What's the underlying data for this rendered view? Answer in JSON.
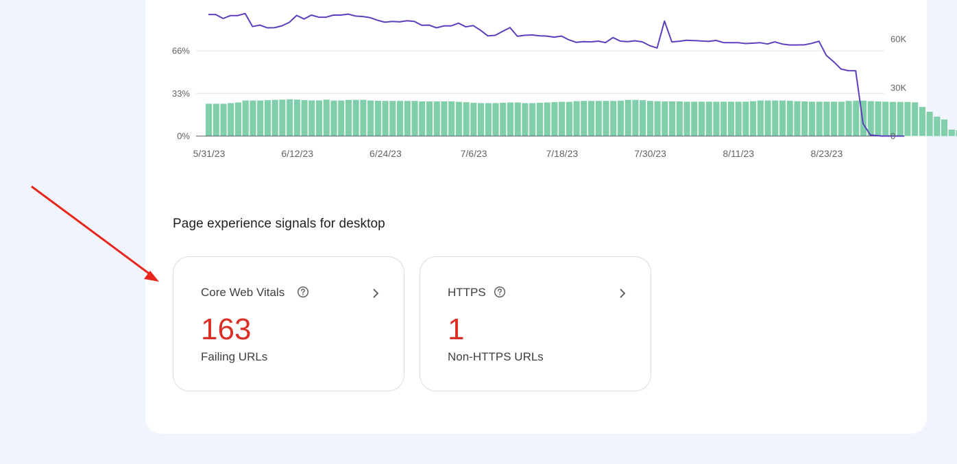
{
  "chart_data": {
    "type": "bar",
    "x_tick_labels": [
      "5/31/23",
      "6/12/23",
      "6/24/23",
      "7/6/23",
      "7/18/23",
      "7/30/23",
      "8/11/23",
      "8/23/23"
    ],
    "left_axis": {
      "ticks": [
        "66%",
        "33%",
        "0%"
      ],
      "range": [
        0,
        100
      ]
    },
    "right_axis": {
      "ticks": [
        "60K",
        "30K",
        "0"
      ],
      "range": [
        0,
        80000
      ]
    },
    "grid": true,
    "series": [
      {
        "type": "bar",
        "axis": "left",
        "color": "#81cfaa",
        "values": [
          25,
          25,
          25,
          25.5,
          26,
          27.5,
          27.5,
          27.5,
          27.8,
          28,
          28.2,
          28.5,
          28.2,
          27.8,
          27.6,
          27.6,
          28.2,
          27.5,
          27.5,
          28,
          28,
          28,
          27.5,
          27.3,
          27.2,
          27.2,
          27.2,
          27.2,
          27.2,
          26.8,
          26.8,
          26.8,
          26.8,
          26.8,
          26.5,
          26.2,
          25.8,
          25.5,
          25.5,
          25.5,
          25.8,
          26,
          26,
          25.5,
          25.5,
          25.8,
          26,
          26.3,
          26.5,
          26.5,
          27,
          27.2,
          27.2,
          27.2,
          27.2,
          27.2,
          27.4,
          28,
          28,
          27.8,
          27.2,
          27,
          26.8,
          26.8,
          26.8,
          26.6,
          26.6,
          26.6,
          26.6,
          26.6,
          26.6,
          26.6,
          26.6,
          26.6,
          27,
          27.5,
          27.5,
          27.5,
          27.5,
          27.3,
          27,
          26.8,
          26.6,
          26.6,
          26.6,
          26.6,
          26.6,
          27.2,
          27.4,
          27.4,
          27,
          26.8,
          26.6,
          26.4,
          26.4,
          26.4,
          26.1,
          22.5,
          18.8,
          15,
          12.8,
          5,
          4.5,
          3.8,
          3,
          2.5,
          2
        ]
      },
      {
        "type": "line",
        "axis": "right",
        "color": "#5c3dbe",
        "values": [
          75300,
          75200,
          72800,
          74600,
          74600,
          75900,
          67800,
          68700,
          67000,
          67100,
          68300,
          70400,
          74700,
          72500,
          74900,
          73600,
          73600,
          74900,
          74900,
          75500,
          74300,
          74000,
          73300,
          71700,
          70500,
          71000,
          70700,
          71400,
          71000,
          68600,
          68700,
          67000,
          68200,
          68200,
          69900,
          67600,
          68400,
          65500,
          62000,
          62400,
          64800,
          67200,
          61800,
          62400,
          62600,
          62100,
          61900,
          61200,
          61900,
          59600,
          58000,
          58500,
          58300,
          58800,
          57900,
          61000,
          58800,
          58500,
          59000,
          58300,
          56000,
          54500,
          71200,
          58300,
          58700,
          59300,
          59100,
          58900,
          58600,
          59200,
          57900,
          57800,
          57800,
          57300,
          57500,
          57800,
          57000,
          58300,
          57000,
          56400,
          56400,
          56500,
          57400,
          58700,
          50000,
          46000,
          41500,
          40500,
          40400
        ]
      }
    ]
  },
  "section": {
    "title": "Page experience signals for desktop"
  },
  "cards": [
    {
      "title": "Core Web Vitals",
      "value": "163",
      "subtitle": "Failing URLs"
    },
    {
      "title": "HTTPS",
      "value": "1",
      "subtitle": "Non-HTTPS URLs"
    }
  ],
  "icons": {
    "help": "help-circle-icon",
    "chevron": "chevron-right-icon",
    "annotation": "red-arrow-icon"
  },
  "colors": {
    "bar": "#81cfaa",
    "line": "#5c3dbe",
    "value": "#d93025",
    "arrow": "#e8251d",
    "background": "#f0f4fc"
  }
}
